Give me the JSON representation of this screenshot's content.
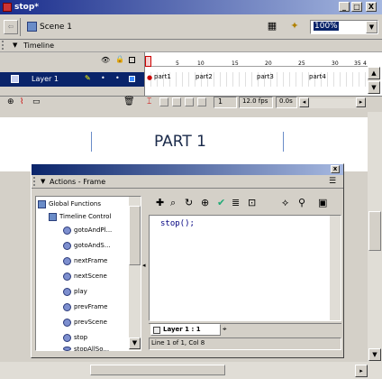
{
  "window": {
    "title": "stop*",
    "min": "_",
    "max": "□",
    "close": "X"
  },
  "scenebar": {
    "scene_label": "Scene 1",
    "zoom": "100%"
  },
  "timeline": {
    "header_label": "Timeline",
    "ruler": [
      "5",
      "10",
      "15",
      "20",
      "25",
      "30",
      "35",
      "4"
    ],
    "layer_name": "Layer 1",
    "labels": [
      "part1",
      "part2",
      "part3",
      "part4"
    ],
    "current_frame": "1",
    "fps": "12.0 fps",
    "time": "0.0s"
  },
  "stage": {
    "heading": "PART 1"
  },
  "actions": {
    "title": "Actions - Frame",
    "tree": {
      "global": "Global Functions",
      "timeline_control": "Timeline Control",
      "items": [
        "gotoAndPl...",
        "gotoAndS...",
        "nextFrame",
        "nextScene",
        "play",
        "prevFrame",
        "prevScene",
        "stop",
        "stopAllSo..."
      ]
    },
    "script": "stop();",
    "tab_label": "Layer 1 : 1",
    "status": "Line 1 of 1, Col 8"
  }
}
